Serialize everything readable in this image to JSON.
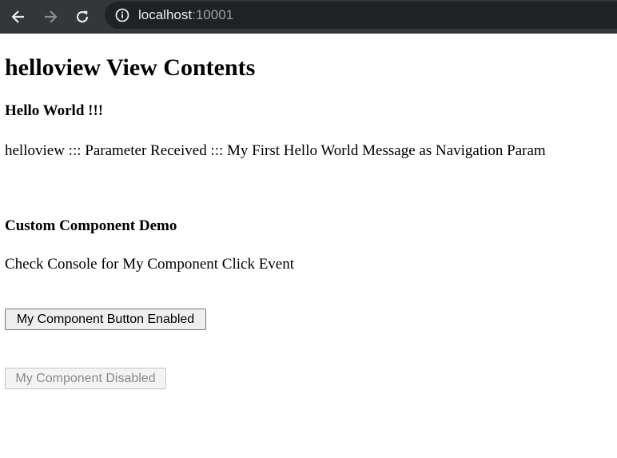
{
  "browser": {
    "url_host": "localhost",
    "url_port": ":10001",
    "icons": {
      "back": "arrow-left-icon",
      "forward": "arrow-right-icon",
      "reload": "reload-icon",
      "site_info": "info-icon"
    }
  },
  "page": {
    "title": "helloview View Contents",
    "hello_heading": "Hello World !!!",
    "param_text": "helloview ::: Parameter Received ::: My First Hello World Message as Navigation Param",
    "demo_heading": "Custom Component Demo",
    "console_text": "Check Console for My Component Click Event",
    "enabled_button_label": "My Component Button Enabled",
    "disabled_button_label": "My Component Disabled"
  }
}
